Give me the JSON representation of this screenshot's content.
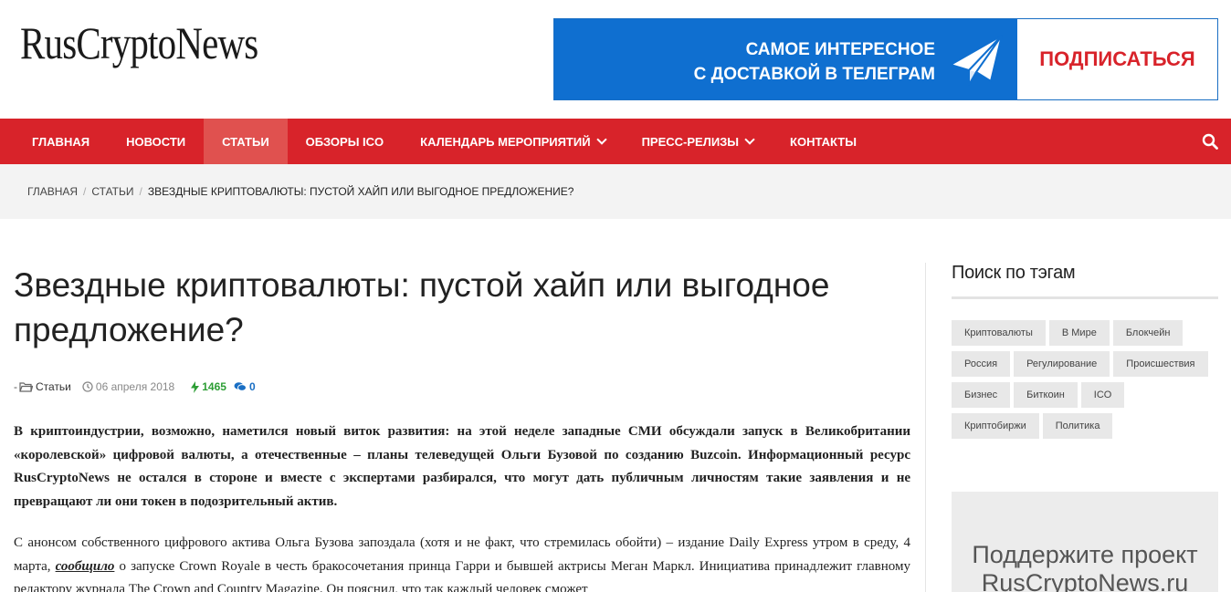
{
  "header": {
    "logo": "RusCryptoNews",
    "banner": {
      "line1": "САМОЕ ИНТЕРЕСНОЕ",
      "line2": "С ДОСТАВКОЙ В ТЕЛЕГРАМ",
      "cta": "ПОДПИСАТЬСЯ",
      "accent": "#0f6fd0",
      "cta_color": "#d8232a"
    }
  },
  "nav": {
    "items": [
      {
        "label": "ГЛАВНАЯ"
      },
      {
        "label": "НОВОСТИ"
      },
      {
        "label": "СТАТЬИ",
        "active": true
      },
      {
        "label": "ОБЗОРЫ ICO"
      },
      {
        "label": "КАЛЕНДАРЬ МЕРОПРИЯТИЙ",
        "dropdown": true
      },
      {
        "label": "ПРЕСС-РЕЛИЗЫ",
        "dropdown": true
      },
      {
        "label": "КОНТАКТЫ"
      }
    ],
    "color": "#d8232a",
    "search_icon": "search-icon"
  },
  "breadcrumb": {
    "home": "ГЛАВНАЯ",
    "section": "СТАТЬИ",
    "current": "ЗВЕЗДНЫЕ КРИПТОВАЛЮТЫ: ПУСТОЙ ХАЙП ИЛИ ВЫГОДНОЕ ПРЕДЛОЖЕНИЕ?"
  },
  "article": {
    "title": "Звездные криптовалюты: пустой хайп или выгодное предложение?",
    "meta": {
      "prefix": "-",
      "category": "Статьи",
      "date": "06 апреля 2018",
      "views": "1465",
      "comments": "0"
    },
    "lead_a": "В криптоиндустрии, возможно, наметился новый виток развития: на этой неделе западные СМИ обсуждали запуск в Великобритании «королевской» цифровой валюты, а отечественные – планы телеведущей Ольги Бузовой по созданию ",
    "lead_b": "Buzcoin",
    "lead_c": ". Информационный ресурс RusCryptoNews не остался в стороне и вместе с экспертами разбирался, что могут дать публичным личностям такие заявления и не превращают ли они токен в подозрительный актив.",
    "body_a": "С анонсом собственного цифрового актива Ольга Бузова запоздала (хотя и не факт, что стремилась обойти) – издание Daily Express утром в среду, 4 марта, ",
    "body_link": "сообщило",
    "body_b": " о запуске Crown Royale в честь бракосочетания принца Гарри и бывшей актрисы Меган Маркл. Инициатива принадлежит главному редактору журнала The Crown and Country Magazine. Он пояснил, что так каждый человек сможет"
  },
  "sidebar": {
    "tags_title": "Поиск по тэгам",
    "tags": [
      "Криптовалюты",
      "В Мире",
      "Блокчейн",
      "Россия",
      "Регулирование",
      "Происшествия",
      "Бизнес",
      "Биткоин",
      "ICO",
      "Криптобиржи",
      "Политика"
    ],
    "support_line1": "Поддержите проект",
    "support_line2": "RusCryptoNews.ru"
  }
}
